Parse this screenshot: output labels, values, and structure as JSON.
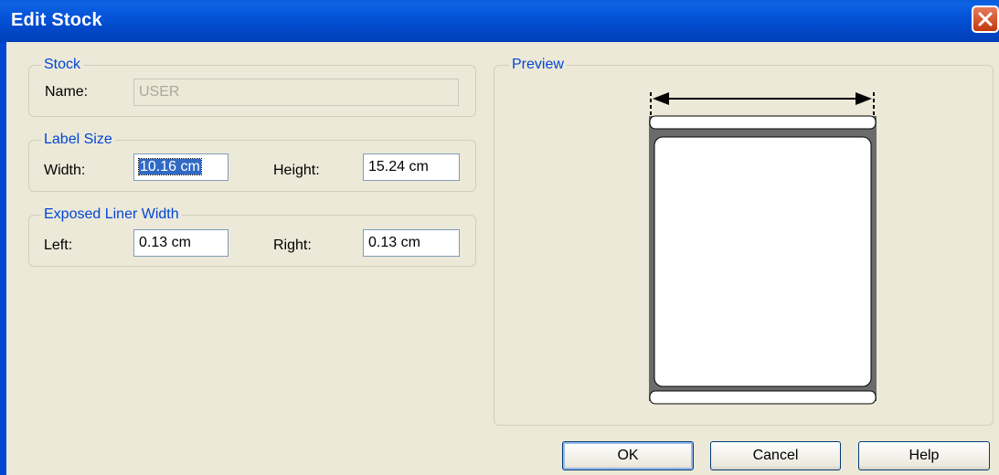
{
  "window": {
    "title": "Edit Stock"
  },
  "stock": {
    "legend": "Stock",
    "name_label": "Name:",
    "name_value": "USER"
  },
  "label_size": {
    "legend": "Label Size",
    "width_label": "Width:",
    "width_value": "10.16 cm",
    "height_label": "Height:",
    "height_value": "15.24 cm"
  },
  "liner": {
    "legend": "Exposed Liner Width",
    "left_label": "Left:",
    "left_value": "0.13 cm",
    "right_label": "Right:",
    "right_value": "0.13 cm"
  },
  "preview": {
    "legend": "Preview"
  },
  "buttons": {
    "ok": "OK",
    "cancel": "Cancel",
    "help": "Help"
  },
  "icons": {
    "close": "close-icon"
  },
  "colors": {
    "titlebar": "#0453d8",
    "group_label": "#0046d5",
    "selection": "#316ac5",
    "dialog_bg": "#ece9d8"
  }
}
